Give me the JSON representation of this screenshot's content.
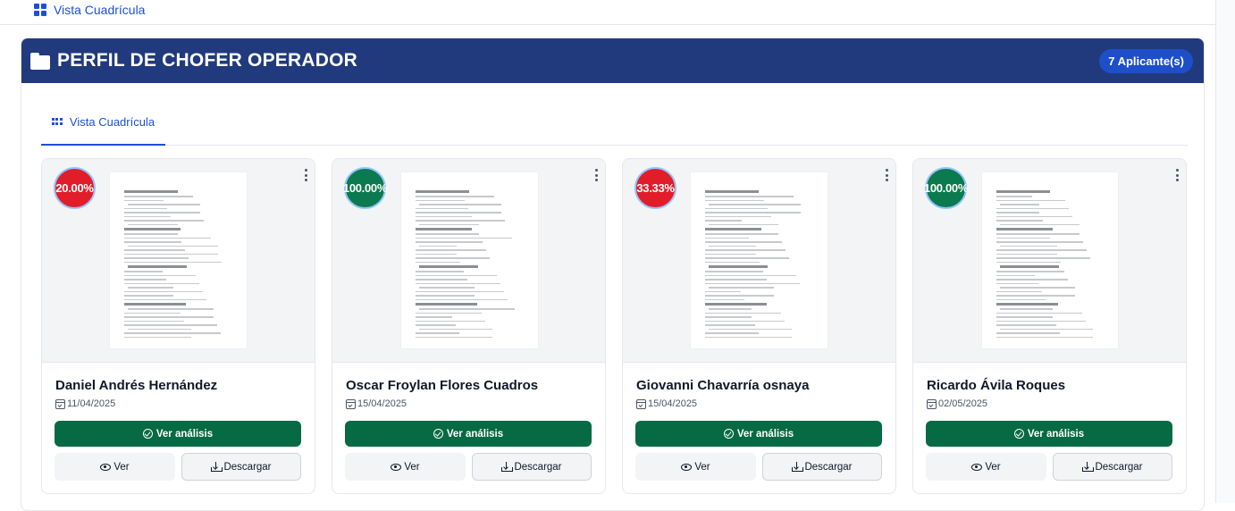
{
  "topbar": {
    "tab_label": "Vista Cuadrícula"
  },
  "panel": {
    "title": "PERFIL DE CHOFER OPERADOR",
    "applicants_badge": "7 Aplicante(s)",
    "tab_label": "Vista Cuadrícula"
  },
  "colors": {
    "header_bg": "#213a7d",
    "badge_bg": "#1e4fc9",
    "primary_button": "#066a44",
    "score_low": "#e11d2a",
    "score_high": "#0b7a4f",
    "accent_blue": "#1d4ed8"
  },
  "icons": {
    "topbar_tab": "grid-icon",
    "panel_title": "folder-icon",
    "subtab": "grid-dots-icon",
    "date": "calendar-check-icon",
    "analysis_button": "check-circle-icon",
    "ver_button": "eye-icon",
    "download_button": "download-icon",
    "card_menu": "more-vertical-icon"
  },
  "buttons": {
    "analysis": "Ver análisis",
    "ver": "Ver",
    "download": "Descargar"
  },
  "cards": [
    {
      "name": "Daniel Andrés Hernández",
      "date": "11/04/2025",
      "score": "20.00%",
      "score_level": "low"
    },
    {
      "name": "Oscar Froylan Flores Cuadros",
      "date": "15/04/2025",
      "score": "100.00%",
      "score_level": "high"
    },
    {
      "name": "Giovanni Chavarría osnaya",
      "date": "15/04/2025",
      "score": "33.33%",
      "score_level": "low"
    },
    {
      "name": "Ricardo Ávila Roques",
      "date": "02/05/2025",
      "score": "100.00%",
      "score_level": "high"
    }
  ]
}
